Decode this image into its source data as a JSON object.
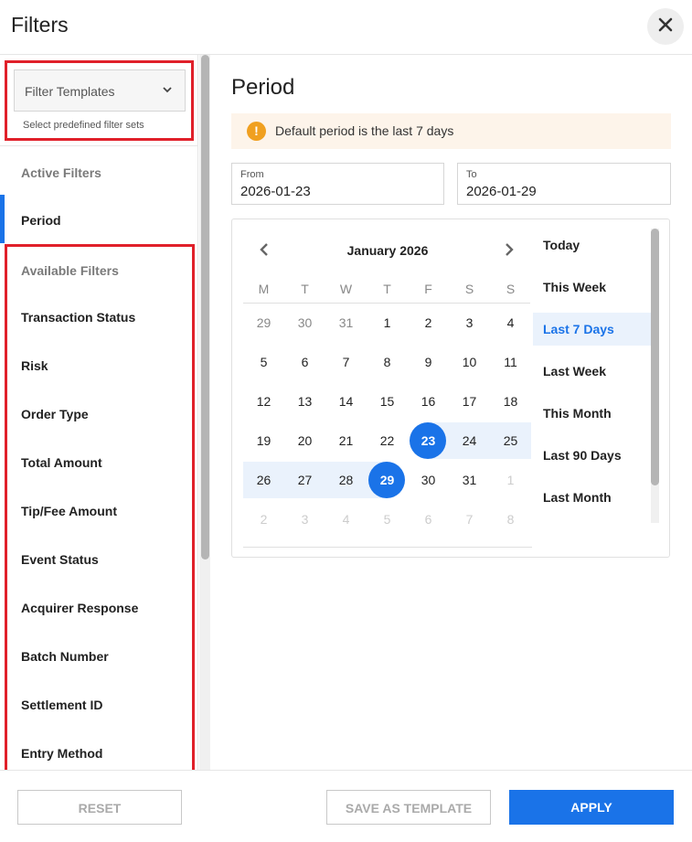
{
  "header": {
    "title": "Filters"
  },
  "templates": {
    "label": "Filter Templates",
    "hint": "Select predefined filter sets"
  },
  "sidebar": {
    "active_heading": "Active Filters",
    "active_items": [
      "Period"
    ],
    "available_heading": "Available Filters",
    "available_items": [
      "Transaction Status",
      "Risk",
      "Order Type",
      "Total Amount",
      "Tip/Fee Amount",
      "Event Status",
      "Acquirer Response",
      "Batch Number",
      "Settlement ID",
      "Entry Method"
    ]
  },
  "main": {
    "title": "Period",
    "notice": "Default period is the last 7 days",
    "from": {
      "caption": "From",
      "value": "2026-01-23"
    },
    "to": {
      "caption": "To",
      "value": "2026-01-29"
    }
  },
  "calendar": {
    "month_label": "January 2026",
    "weekdays": [
      "M",
      "T",
      "W",
      "T",
      "F",
      "S",
      "S"
    ],
    "weeks": [
      [
        "29",
        "30",
        "31",
        "1",
        "2",
        "3",
        "4"
      ],
      [
        "5",
        "6",
        "7",
        "8",
        "9",
        "10",
        "11"
      ],
      [
        "12",
        "13",
        "14",
        "15",
        "16",
        "17",
        "18"
      ],
      [
        "19",
        "20",
        "21",
        "22",
        "23",
        "24",
        "25"
      ],
      [
        "26",
        "27",
        "28",
        "29",
        "30",
        "31",
        "1"
      ],
      [
        "2",
        "3",
        "4",
        "5",
        "6",
        "7",
        "8"
      ]
    ],
    "selected_start": "23",
    "selected_end": "29",
    "presets": [
      "Today",
      "This Week",
      "Last 7 Days",
      "Last Week",
      "This Month",
      "Last 90 Days",
      "Last Month"
    ],
    "active_preset": "Last 7 Days"
  },
  "footer": {
    "reset_label": "RESET",
    "save_template_label": "SAVE AS TEMPLATE",
    "apply_label": "APPLY"
  },
  "colors": {
    "accent": "#1a73e8",
    "highlight_border": "#e0202a",
    "notice_bg": "#fdf4ea",
    "warning_icon": "#f0a020"
  }
}
